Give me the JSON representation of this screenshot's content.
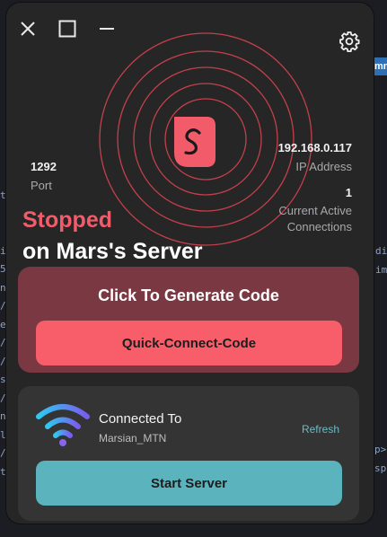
{
  "window": {
    "controls": {
      "close_icon": "close-icon",
      "maximize_icon": "maximize-icon",
      "minimize_icon": "minimize-icon",
      "settings_icon": "gear-icon"
    }
  },
  "stats": {
    "port": {
      "value": "1292",
      "label": "Port"
    },
    "ip": {
      "value": "192.168.0.117",
      "label": "IP Address"
    },
    "connections": {
      "value": "1",
      "label_line1": "Current Active",
      "label_line2": "Connections"
    }
  },
  "status": {
    "word": "Stopped",
    "server_line": "on Mars's Server"
  },
  "code_card": {
    "title": "Click To Generate Code",
    "button_label": "Quick-Connect-Code"
  },
  "network": {
    "title": "Connected To",
    "name": "Marsian_MTN",
    "refresh_label": "Refresh",
    "start_label": "Start Server"
  },
  "colors": {
    "accent_red": "#f85d6a",
    "accent_teal": "#5bb3bd",
    "card_red": "#7a3942",
    "window_bg": "#262626"
  }
}
